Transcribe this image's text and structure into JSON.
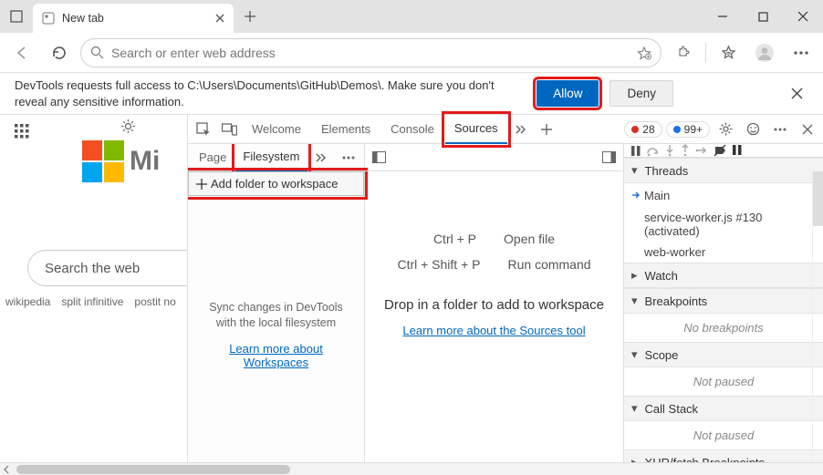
{
  "titlebar": {
    "tab_title": "New tab"
  },
  "toolbar": {
    "placeholder": "Search or enter web address"
  },
  "permission": {
    "text": "DevTools requests full access to C:\\Users\\Documents\\GitHub\\Demos\\. Make sure you don't reveal any sensitive information.",
    "allow": "Allow",
    "deny": "Deny"
  },
  "page": {
    "brand_partial": "Mi",
    "search_placeholder": "Search the web",
    "quicklinks": [
      "wikipedia",
      "split infinitive",
      "postit no"
    ]
  },
  "devtools": {
    "tabs": [
      "Welcome",
      "Elements",
      "Console",
      "Sources"
    ],
    "active_tab": "Sources",
    "errors": "28",
    "info": "99+",
    "sources": {
      "nav_tabs": [
        "Page",
        "Filesystem"
      ],
      "active_nav": "Filesystem",
      "add_folder": "Add folder to workspace",
      "sync_hint": "Sync changes in DevTools with the local filesystem",
      "learn_workspaces": "Learn more about Workspaces"
    },
    "editor": {
      "shortcut_open_keys": "Ctrl + P",
      "shortcut_open_label": "Open file",
      "shortcut_cmd_keys": "Ctrl + Shift + P",
      "shortcut_cmd_label": "Run command",
      "drop_hint": "Drop in a folder to add to workspace",
      "learn_sources": "Learn more about the Sources tool"
    },
    "debugger": {
      "sections": {
        "threads": "Threads",
        "watch": "Watch",
        "breakpoints": "Breakpoints",
        "scope": "Scope",
        "callstack": "Call Stack",
        "xhr": "XHR/fetch Breakpoints"
      },
      "threads": {
        "main": "Main",
        "sw": "service-worker.js #130 (activated)",
        "ww": "web-worker"
      },
      "no_breakpoints": "No breakpoints",
      "not_paused": "Not paused"
    }
  }
}
